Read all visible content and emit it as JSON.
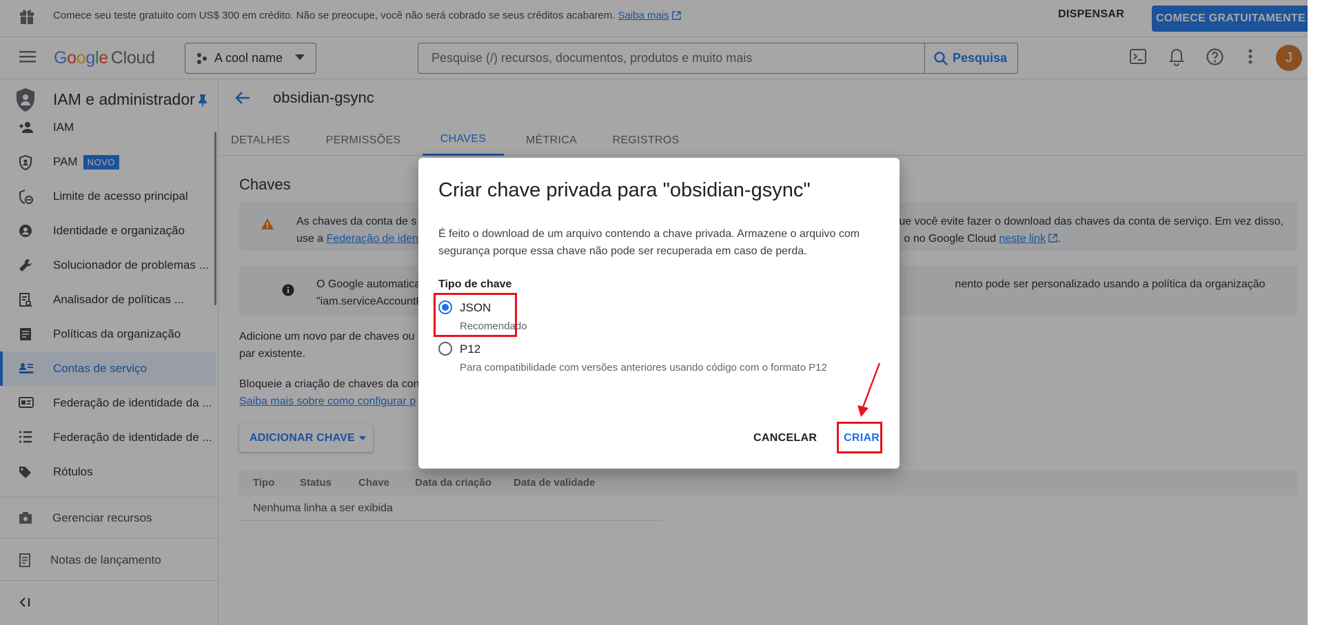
{
  "promo": {
    "text": "Comece seu teste gratuito com US$ 300 em crédito. Não se preocupe, você não será cobrado se seus créditos acabarem.",
    "link": "Saiba mais",
    "dismiss": "DISPENSAR",
    "start": "COMECE GRATUITAMENTE"
  },
  "topbar": {
    "logo_google": "Google",
    "logo_cloud": "Cloud",
    "project": "A cool name",
    "search_placeholder": "Pesquise (/) recursos, documentos, produtos e muito mais",
    "search_button": "Pesquisa",
    "avatar_initial": "J"
  },
  "sidebar": {
    "title": "IAM e administrador",
    "items": [
      {
        "label": "IAM",
        "icon": "person-add-icon"
      },
      {
        "label": "PAM",
        "badge": "NOVO",
        "icon": "shield-icon"
      },
      {
        "label": "Limite de acesso principal",
        "icon": "boundary-icon"
      },
      {
        "label": "Identidade e organização",
        "icon": "account-circle-icon"
      },
      {
        "label": "Solucionador de problemas ...",
        "icon": "wrench-icon"
      },
      {
        "label": "Analisador de políticas ...",
        "icon": "policy-analyzer-icon"
      },
      {
        "label": "Políticas da organização",
        "icon": "document-icon"
      },
      {
        "label": "Contas de serviço",
        "icon": "service-account-icon"
      },
      {
        "label": "Federação de identidade da ...",
        "icon": "id-card-icon"
      },
      {
        "label": "Federação de identidade de ...",
        "icon": "list-icon"
      },
      {
        "label": "Rótulos",
        "icon": "label-icon"
      }
    ],
    "manage_resources": "Gerenciar recursos",
    "release_notes": "Notas de lançamento",
    "collapse": "<I"
  },
  "main": {
    "page_title": "obsidian-gsync",
    "tabs": [
      "DETALHES",
      "PERMISSÕES",
      "CHAVES",
      "MÉTRICA",
      "REGISTROS"
    ],
    "active_tab": "CHAVES",
    "section_title": "Chaves",
    "warning": {
      "line1_left": "As chaves da conta de s",
      "line1_right": "ue você evite fazer o download das chaves da conta de serviço. Em vez disso,",
      "line2_prefix": "use a ",
      "line2_link": "Federação de ident",
      "line2_right_text": "o no Google Cloud ",
      "line2_right_link": "neste link",
      "line2_end": "."
    },
    "info": {
      "line1_left": "O Google automaticame",
      "line1_right": "nento pode ser personalizado usando a política da organização",
      "line2_left": "\"iam.serviceAccountKey"
    },
    "add_text_line1": "Adicione um novo par de chaves ou",
    "add_text_line2": "par existente.",
    "block_text": "Bloqueie a criação de chaves da con",
    "block_link": "Saiba mais sobre como configurar p",
    "add_key_button": "ADICIONAR CHAVE",
    "table_headers": [
      "Tipo",
      "Status",
      "Chave",
      "Data da criação",
      "Data de validade"
    ],
    "empty_row": "Nenhuma linha a ser exibida"
  },
  "dialog": {
    "title": "Criar chave privada para \"obsidian-gsync\"",
    "description": "É feito o download de um arquivo contendo a chave privada. Armazene o arquivo com segurança porque essa chave não pode ser recuperada em caso de perda.",
    "key_type_label": "Tipo de chave",
    "options": [
      {
        "name": "JSON",
        "sub": "Recomendado",
        "selected": true
      },
      {
        "name": "P12",
        "sub": "Para compatibilidade com versões anteriores usando código com o formato P12",
        "selected": false
      }
    ],
    "cancel": "CANCELAR",
    "create": "CRIAR"
  },
  "colors": {
    "accent": "#1a73e8",
    "highlight": "#e8131b",
    "avatar": "#d26e1f"
  }
}
